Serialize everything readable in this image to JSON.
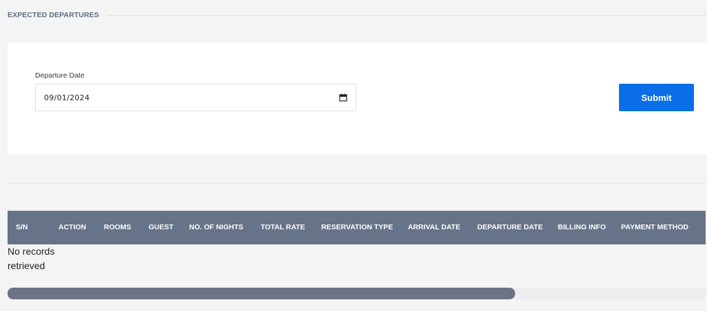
{
  "section": {
    "title": "EXPECTED DEPARTURES"
  },
  "filter": {
    "label": "Departure Date",
    "value": "09/01/2024",
    "submit_label": "Submit"
  },
  "table": {
    "columns": [
      "S/N",
      "ACTION",
      "ROOMS",
      "GUEST",
      "NO. OF NIGHTS",
      "TOTAL RATE",
      "RESERVATION TYPE",
      "ARRIVAL DATE",
      "DEPARTURE DATE",
      "BILLING INFO",
      "PAYMENT METHOD"
    ],
    "empty_message": "No records retrieved",
    "scroll_position_fraction": 0.73
  },
  "colors": {
    "accent": "#0a6fe6",
    "table_header": "#667389",
    "section_title": "#5e6b80"
  },
  "icons": {
    "date_picker": "calendar-icon"
  }
}
